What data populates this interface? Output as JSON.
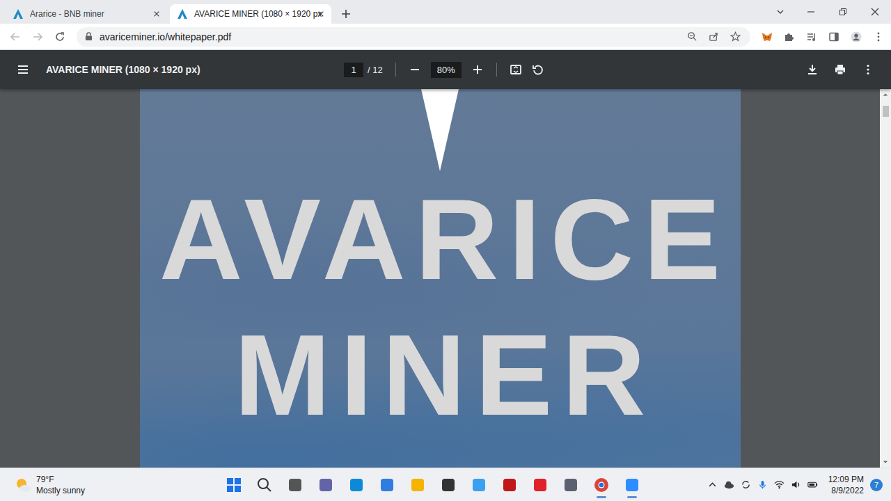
{
  "browser": {
    "tabs": [
      {
        "label": "Ararice - BNB miner",
        "selected": false
      },
      {
        "label": "AVARICE MINER (1080 × 1920 px",
        "selected": true
      }
    ],
    "address": "avariceminer.io/whitepaper.pdf"
  },
  "pdf_viewer": {
    "title": "AVARICE MINER (1080 × 1920 px)",
    "page": "1",
    "page_count": "/ 12",
    "zoom": "80%"
  },
  "document": {
    "lines": [
      "AVARICE",
      "MINER"
    ]
  },
  "taskbar": {
    "weather": {
      "temperature": "79°F",
      "condition": "Mostly sunny"
    },
    "time": "12:09 PM",
    "date": "8/9/2022",
    "notification_count": "7"
  }
}
